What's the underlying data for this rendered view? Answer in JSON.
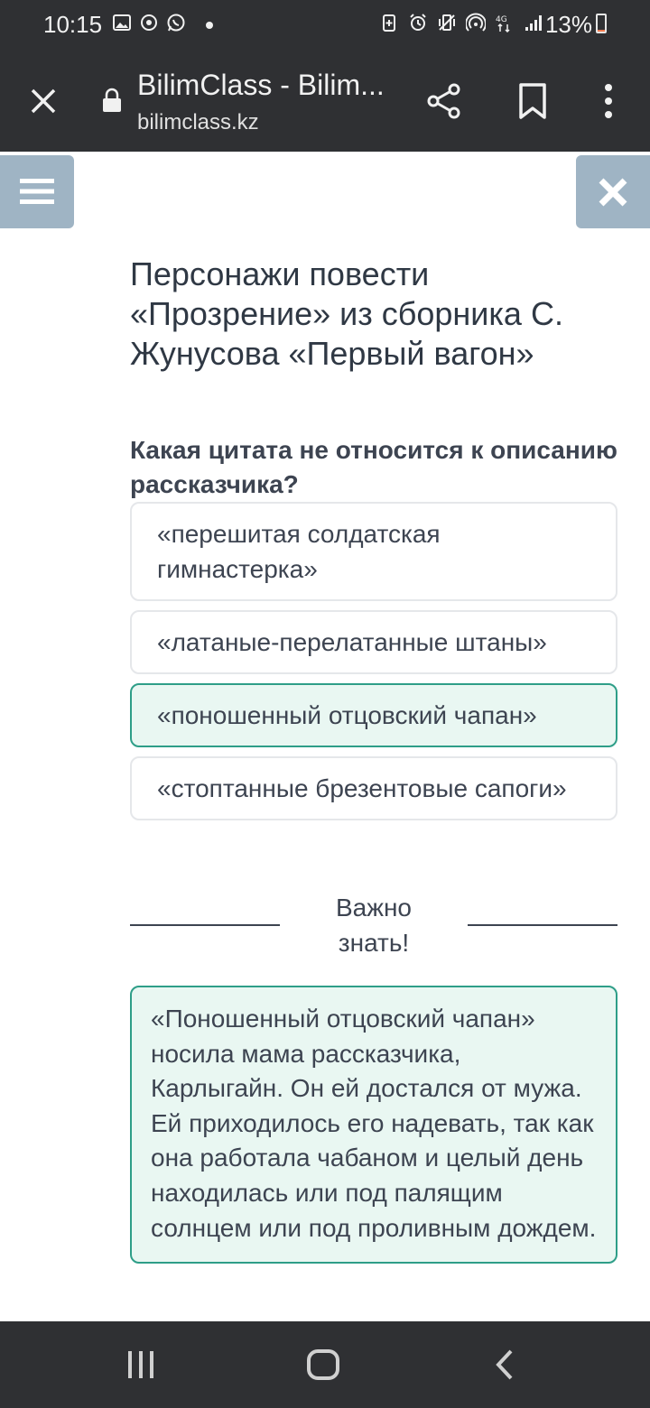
{
  "status_bar": {
    "time": "10:15",
    "battery": "13%",
    "battery_level": 0.13,
    "left_icons": [
      "gallery-icon",
      "sync-icon",
      "whatsapp-icon",
      "notification-dot"
    ],
    "right_icons": [
      "battery-saver-icon",
      "alarm-icon",
      "vibrate-icon",
      "hotspot-icon",
      "4g-icon",
      "signal-icon"
    ]
  },
  "browser": {
    "page_title": "BilimClass - Bilim...",
    "url": "bilimclass.kz"
  },
  "lesson": {
    "title": "Персонажи повести «Прозрение» из сборника С. Жунусова «Первый вагон»"
  },
  "quiz": {
    "question": "Какая цитата не относится к описанию рассказчика?",
    "answers": [
      {
        "text": "«перешитая солдатская гимнастерка»",
        "selected": false
      },
      {
        "text": "«латаные-перелатанные штаны»",
        "selected": false
      },
      {
        "text": "«поношенный отцовский чапан»",
        "selected": true
      },
      {
        "text": "«стоптанные брезентовые сапоги»",
        "selected": false
      }
    ]
  },
  "info": {
    "heading": "Важно знать!",
    "text": "«Поношенный отцовский чапан» носила мама рассказчика, Карлыгайн. Он ей достался от мужа. Ей приходилось его надевать, так как она работала чабаном и целый день находилась или под палящим солнцем или под проливным дождем."
  },
  "colors": {
    "system_bar": "#2f3033",
    "side_button": "#9fb4c4",
    "selected_border": "#2e9e88",
    "selected_bg": "#e9f7f2",
    "text": "#3d4451",
    "battery_fill": "#f07a4f"
  }
}
